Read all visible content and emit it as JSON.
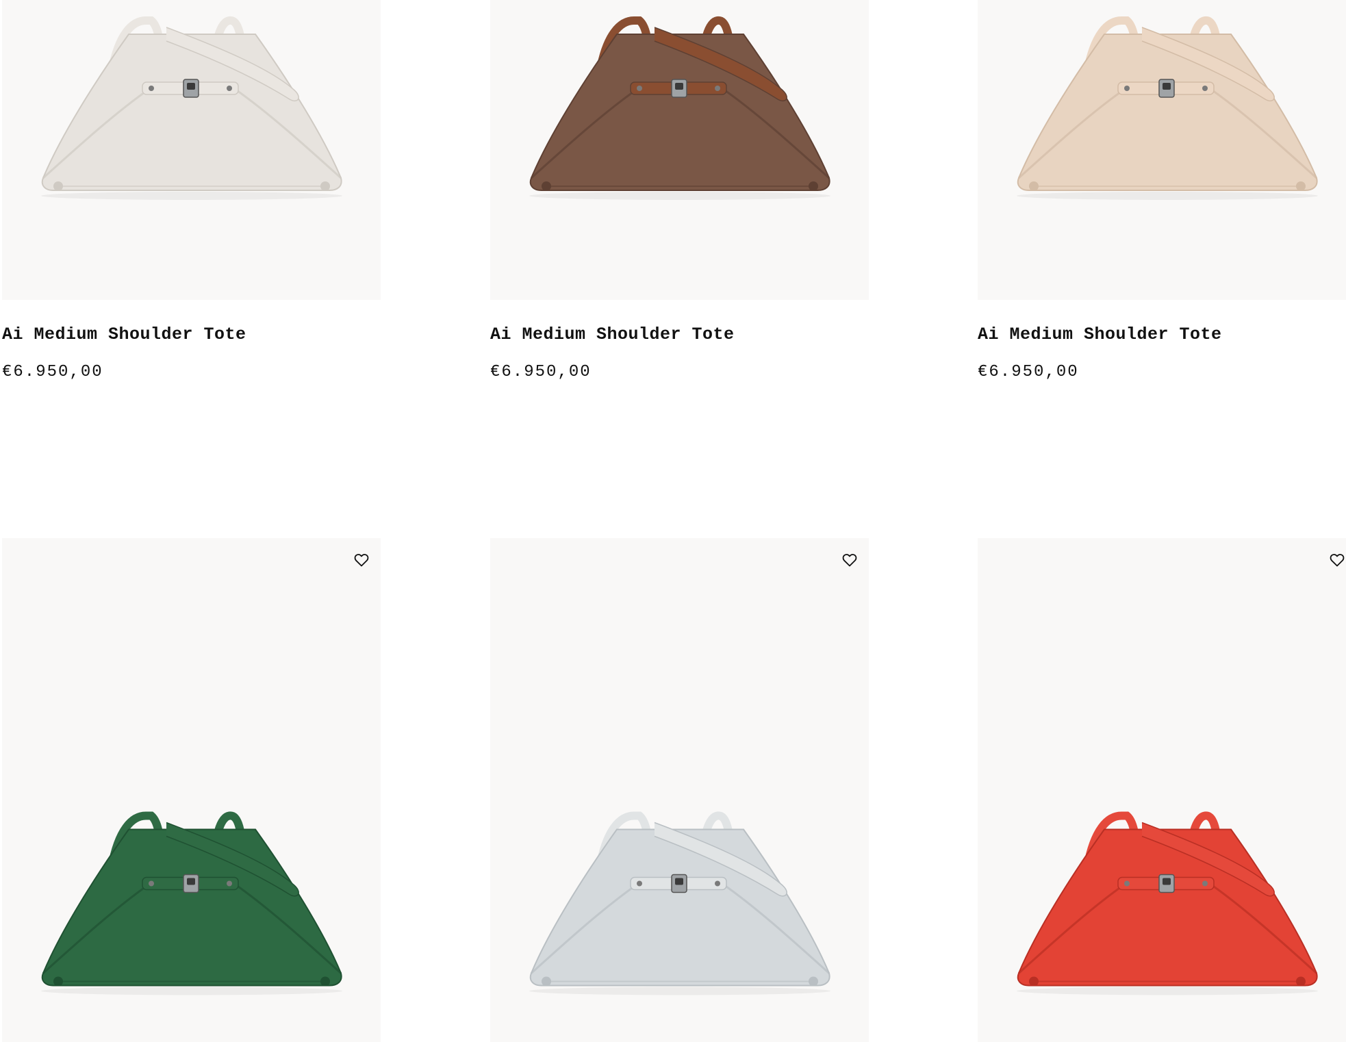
{
  "products": [
    {
      "name": "Ai Medium Shoulder Tote",
      "price": "€6.950,00",
      "color": "#e7e3de",
      "strap": "#eae6e1",
      "shade": "#cfcac3"
    },
    {
      "name": "Ai Medium Shoulder Tote",
      "price": "€6.950,00",
      "color": "#7a5746",
      "strap": "#8a4e31",
      "shade": "#5e4033"
    },
    {
      "name": "Ai Medium Shoulder Tote",
      "price": "€6.950,00",
      "color": "#e8d4c1",
      "strap": "#ecd7c4",
      "shade": "#d3bca6"
    },
    {
      "name": "",
      "price": "",
      "color": "#2d6a43",
      "strap": "#2f6b44",
      "shade": "#1f5132",
      "favorite_icon": "heart-outline-icon"
    },
    {
      "name": "",
      "price": "",
      "color": "#d4d9dc",
      "strap": "#e1e4e5",
      "shade": "#b9bfc3",
      "favorite_icon": "heart-outline-icon"
    },
    {
      "name": "",
      "price": "",
      "color": "#e34335",
      "strap": "#e5493b",
      "shade": "#b92f24",
      "favorite_icon": "heart-outline-icon"
    }
  ]
}
